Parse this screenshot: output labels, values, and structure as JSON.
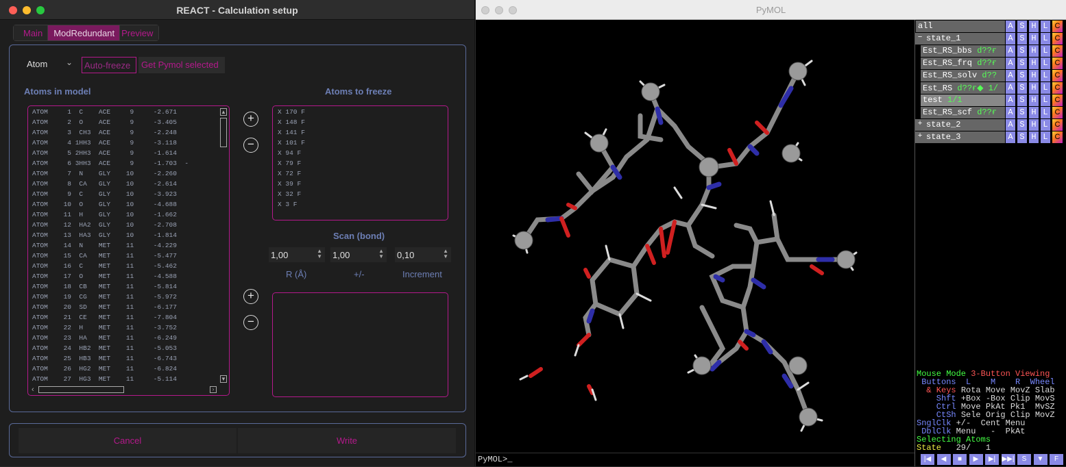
{
  "react": {
    "window_title": "REACT - Calculation setup",
    "tabs": [
      "Main",
      "ModRedundant",
      "Preview"
    ],
    "atom_type_select": "Atom",
    "auto_freeze_label": "Auto-freeze",
    "get_pymol_selected_label": "Get Pymol selected",
    "atoms_in_model_label": "Atoms in model",
    "atoms_to_freeze_label": "Atoms to freeze",
    "atoms_in_model": [
      "ATOM     1  C    ACE     9     -2.671",
      "ATOM     2  O    ACE     9     -3.405",
      "ATOM     3  CH3  ACE     9     -2.248",
      "ATOM     4 1HH3  ACE     9     -3.118",
      "ATOM     5 2HH3  ACE     9     -1.614",
      "ATOM     6 3HH3  ACE     9     -1.703  -",
      "ATOM     7  N    GLY    10     -2.260",
      "ATOM     8  CA   GLY    10     -2.614",
      "ATOM     9  C    GLY    10     -3.923",
      "ATOM    10  O    GLY    10     -4.688",
      "ATOM    11  H    GLY    10     -1.662",
      "ATOM    12  HA2  GLY    10     -2.708",
      "ATOM    13  HA3  GLY    10     -1.814",
      "ATOM    14  N    MET    11     -4.229",
      "ATOM    15  CA   MET    11     -5.477",
      "ATOM    16  C    MET    11     -5.462",
      "ATOM    17  O    MET    11     -4.588",
      "ATOM    18  CB   MET    11     -5.814",
      "ATOM    19  CG   MET    11     -5.972",
      "ATOM    20  SD   MET    11     -6.177",
      "ATOM    21  CE   MET    11     -7.804",
      "ATOM    22  H    MET    11     -3.752",
      "ATOM    23  HA   MET    11     -6.249",
      "ATOM    24  HB2  MET    11     -5.053",
      "ATOM    25  HB3  MET    11     -6.743",
      "ATOM    26  HG2  MET    11     -6.824",
      "ATOM    27  HG3  MET    11     -5.114"
    ],
    "atoms_to_freeze": [
      "X 170 F",
      "X 148 F",
      "X 141 F",
      "X 101 F",
      "X 94 F",
      "X 79 F",
      "X 72 F",
      "X 39 F",
      "X 32 F",
      "X 3 F"
    ],
    "scan_label": "Scan (bond)",
    "scan_r": "1,00",
    "scan_pm": "1,00",
    "scan_increment": "0,10",
    "scan_r_label": "R (Å)",
    "scan_pm_label": "+/-",
    "scan_increment_label": "Increment",
    "plus_glyph": "+",
    "minus_glyph": "−",
    "cancel_label": "Cancel",
    "write_label": "Write"
  },
  "pymol": {
    "window_title": "PyMOL",
    "command_prompt": "PyMOL>_",
    "objects": [
      {
        "name": "all",
        "extra": "",
        "indent": 0,
        "toggle": ""
      },
      {
        "name": "state_1",
        "extra": "",
        "indent": 0,
        "toggle": "−"
      },
      {
        "name": "Est_RS_bbs",
        "extra": "d??ғ",
        "indent": 1,
        "toggle": ""
      },
      {
        "name": "Est_RS_frq",
        "extra": "d??ғ",
        "indent": 1,
        "toggle": ""
      },
      {
        "name": "Est_RS_solv",
        "extra": "d??",
        "indent": 1,
        "toggle": ""
      },
      {
        "name": "Est_RS",
        "extra": "d??ғ◆ 1/",
        "indent": 1,
        "toggle": ""
      },
      {
        "name": "test",
        "extra": "1/1",
        "indent": 1,
        "toggle": ""
      },
      {
        "name": "Est_RS_scf",
        "extra": "d??ғ",
        "indent": 1,
        "toggle": ""
      },
      {
        "name": "state_2",
        "extra": "",
        "indent": 0,
        "toggle": "+"
      },
      {
        "name": "state_3",
        "extra": "",
        "indent": 0,
        "toggle": "+"
      }
    ],
    "action_buttons": [
      "A",
      "S",
      "H",
      "L",
      "C"
    ],
    "mouse_mode": {
      "line1_a": "Mouse Mode ",
      "line1_b": "3-Button Viewing",
      "line2": " Buttons  L    M    R  Wheel",
      "line3_a": "  & Keys ",
      "line3_b": "Rota Move MovZ Slab",
      "line4_a": "    Shft ",
      "line4_b": "+Box -Box Clip MovS",
      "line5_a": "    Ctrl ",
      "line5_b": "Move PkAt Pk1  MvSZ",
      "line6_a": "    CtSh ",
      "line6_b": "Sele Orig Clip MovZ",
      "line7_a": "SnglClk ",
      "line7_b": "+/-  Cent Menu",
      "line8_a": " DblClk ",
      "line8_b": "Menu   -  PkAt",
      "line9": "Selecting Atoms",
      "line10_a": "State   ",
      "line10_b": "29/   1"
    },
    "movie_controls": [
      "|◀",
      "◀",
      "■",
      "▶",
      "▶|",
      "▶▶|",
      "S",
      "▼",
      "F"
    ]
  }
}
